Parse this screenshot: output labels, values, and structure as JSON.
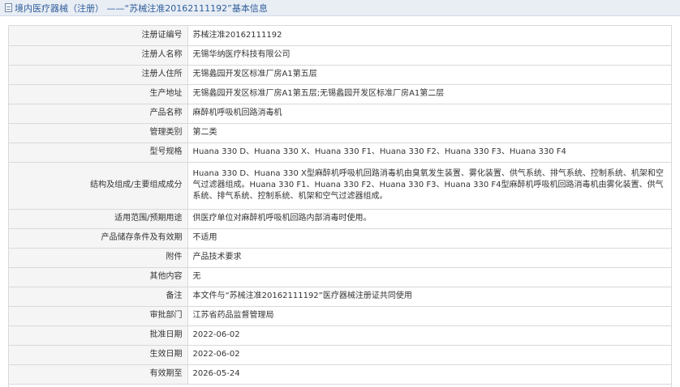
{
  "header": {
    "title": "境内医疗器械（注册） ——“苏械注准20162111192”基本信息"
  },
  "rows": [
    {
      "label": "注册证编号",
      "value": "苏械注准20162111192"
    },
    {
      "label": "注册人名称",
      "value": "无锡华纳医疗科技有限公司"
    },
    {
      "label": "注册人住所",
      "value": "无锡蠡园开发区标准厂房A1第五层"
    },
    {
      "label": "生产地址",
      "value": "无锡蠡园开发区标准厂房A1第五层;无锡蠡园开发区标准厂房A1第二层"
    },
    {
      "label": "产品名称",
      "value": "麻醉机呼吸机回路消毒机"
    },
    {
      "label": "管理类别",
      "value": "第二类"
    },
    {
      "label": "型号规格",
      "value": "Huana 330 D、Huana 330 X、Huana 330 F1、Huana 330 F2、Huana 330 F3、Huana 330 F4"
    },
    {
      "label": "结构及组成/主要组成成分",
      "value": "Huana 330 D、Huana 330 X型麻醉机呼吸机回路消毒机由臭氧发生装置、雾化装置、供气系统、排气系统、控制系统、机架和空气过滤器组成。Huana 330 F1、Huana 330 F2、Huana 330 F3、Huana 330 F4型麻醉机呼吸机回路消毒机由雾化装置、供气系统、排气系统、控制系统、机架和空气过滤器组成。"
    },
    {
      "label": "适用范围/预期用途",
      "value": "供医疗单位对麻醉机呼吸机回路内部消毒时使用。"
    },
    {
      "label": "产品储存条件及有效期",
      "value": "不适用"
    },
    {
      "label": "附件",
      "value": "产品技术要求"
    },
    {
      "label": "其他内容",
      "value": "无"
    },
    {
      "label": "备注",
      "value": "本文件与“苏械注准20162111192”医疗器械注册证共同使用"
    },
    {
      "label": "审批部门",
      "value": "江苏省药品监督管理局"
    },
    {
      "label": "批准日期",
      "value": "2022-06-02"
    },
    {
      "label": "生效日期",
      "value": "2022-06-02"
    },
    {
      "label": "有效期至",
      "value": "2026-05-24"
    }
  ]
}
